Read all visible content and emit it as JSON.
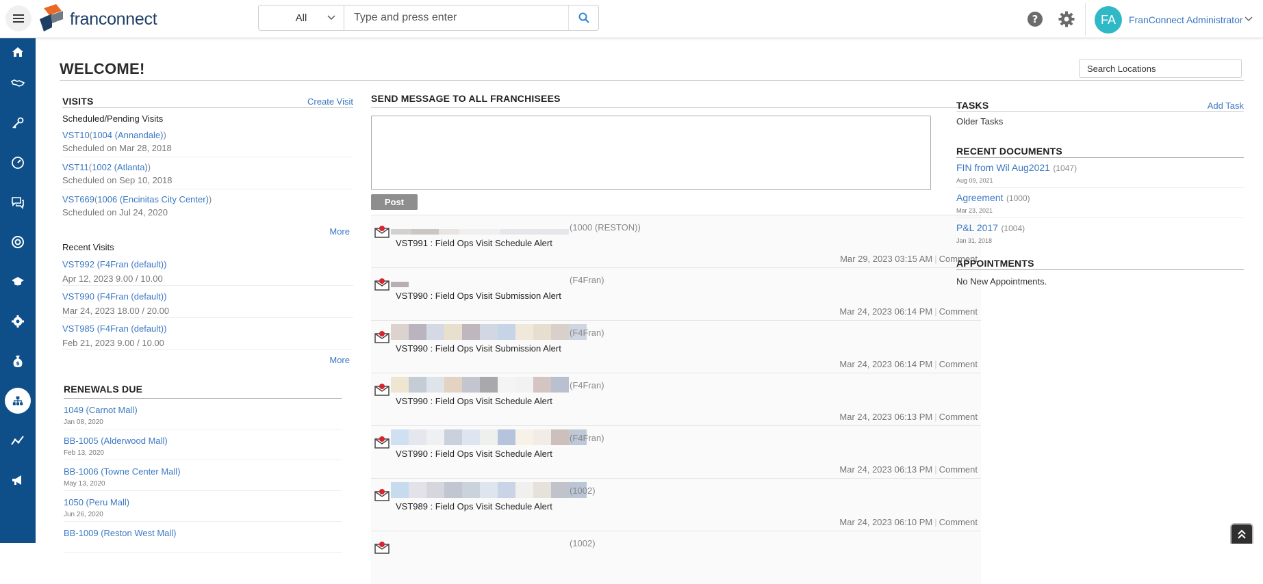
{
  "header": {
    "logo_text": "franconnect",
    "search_scope": "All",
    "search_placeholder": "Type and press enter",
    "user_initials": "FA",
    "user_name": "FranConnect Administrator"
  },
  "colors": {
    "sidebar": "#0e4f8a",
    "link": "#3a78c3",
    "avatar": "#2fb9c6",
    "post_button": "#8e8e8e"
  },
  "sidebar": {
    "items": [
      {
        "icon": "home-icon"
      },
      {
        "icon": "handshake-icon"
      },
      {
        "icon": "key-icon"
      },
      {
        "icon": "dashboard-gauge-icon"
      },
      {
        "icon": "chat-icon"
      },
      {
        "icon": "support-lifebuoy-icon"
      },
      {
        "icon": "graduation-cap-icon"
      },
      {
        "icon": "gear-icon"
      },
      {
        "icon": "money-bag-icon"
      },
      {
        "icon": "org-chart-icon",
        "active": true
      },
      {
        "icon": "trend-line-icon"
      },
      {
        "icon": "megaphone-icon"
      }
    ]
  },
  "page": {
    "title": "WELCOME!",
    "search_locations_placeholder": "Search Locations"
  },
  "visits": {
    "title": "VISITS",
    "create_label": "Create Visit",
    "scheduled_label": "Scheduled/Pending Visits",
    "scheduled": [
      {
        "code": "VST10",
        "location": "1004 (Annandale)",
        "sub": "Scheduled on Mar 28, 2018"
      },
      {
        "code": "VST11",
        "location": "1002 (Atlanta)",
        "sub": "Scheduled on Sep 10, 2018"
      },
      {
        "code": "VST669",
        "location": "1006 (Encinitas City Center)",
        "sub": "Scheduled on Jul 24, 2020"
      }
    ],
    "more_label": "More",
    "recent_label": "Recent Visits",
    "recent": [
      {
        "text": "VST992 (F4Fran (default))",
        "sub": "Apr 12, 2023  9.00 / 10.00"
      },
      {
        "text": "VST990 (F4Fran (default))",
        "sub": "Mar 24, 2023  18.00 / 20.00"
      },
      {
        "text": "VST985 (F4Fran (default))",
        "sub": "Feb 21, 2023  9.00 / 10.00"
      }
    ]
  },
  "renewals": {
    "title": "RENEWALS DUE",
    "items": [
      {
        "name": "1049 (Carnot Mall)",
        "date": "Jan 08, 2020"
      },
      {
        "name": "BB-1005 (Alderwood Mall)",
        "date": "Feb 13, 2020"
      },
      {
        "name": "BB-1006 (Towne Center Mall)",
        "date": "May 13, 2020"
      },
      {
        "name": "1050 (Peru Mall)",
        "date": "Jun 26, 2020"
      },
      {
        "name": "BB-1009 (Reston West Mall)",
        "date": ""
      }
    ]
  },
  "message": {
    "title": "SEND MESSAGE TO ALL FRANCHISEES",
    "post_label": "Post",
    "comment_label": "Comment",
    "feed": [
      {
        "location": "(1000 (RESTON))",
        "title": "VST991 : Field Ops Visit Schedule Alert",
        "time": "Mar 29, 2023 03:15 AM"
      },
      {
        "location": "(F4Fran)",
        "title": "VST990 : Field Ops Visit Submission Alert",
        "time": "Mar 24, 2023 06:14 PM"
      },
      {
        "location": "(F4Fran)",
        "title": "VST990 : Field Ops Visit Submission Alert",
        "time": "Mar 24, 2023 06:14 PM"
      },
      {
        "location": "(F4Fran)",
        "title": "VST990 : Field Ops Visit Schedule Alert",
        "time": "Mar 24, 2023 06:13 PM"
      },
      {
        "location": "(F4Fran)",
        "title": "VST990 : Field Ops Visit Schedule Alert",
        "time": "Mar 24, 2023 06:13 PM"
      },
      {
        "location": "(1002)",
        "title": "VST989 : Field Ops Visit Schedule Alert",
        "time": "Mar 24, 2023 06:10 PM"
      },
      {
        "location": "(1002)",
        "title": "",
        "time": ""
      }
    ]
  },
  "tasks": {
    "title": "TASKS",
    "add_label": "Add Task",
    "older_label": "Older Tasks"
  },
  "documents": {
    "title": "RECENT DOCUMENTS",
    "items": [
      {
        "name": "FIN from Wil Aug2021",
        "count": "(1047)",
        "date": "Aug 09, 2021"
      },
      {
        "name": "Agreement",
        "count": "(1000)",
        "date": "Mar 23, 2021"
      },
      {
        "name": "P&L 2017",
        "count": "(1004)",
        "date": "Jan 31, 2018"
      }
    ]
  },
  "appointments": {
    "title": "APPOINTMENTS",
    "empty_text": "No New Appointments."
  }
}
